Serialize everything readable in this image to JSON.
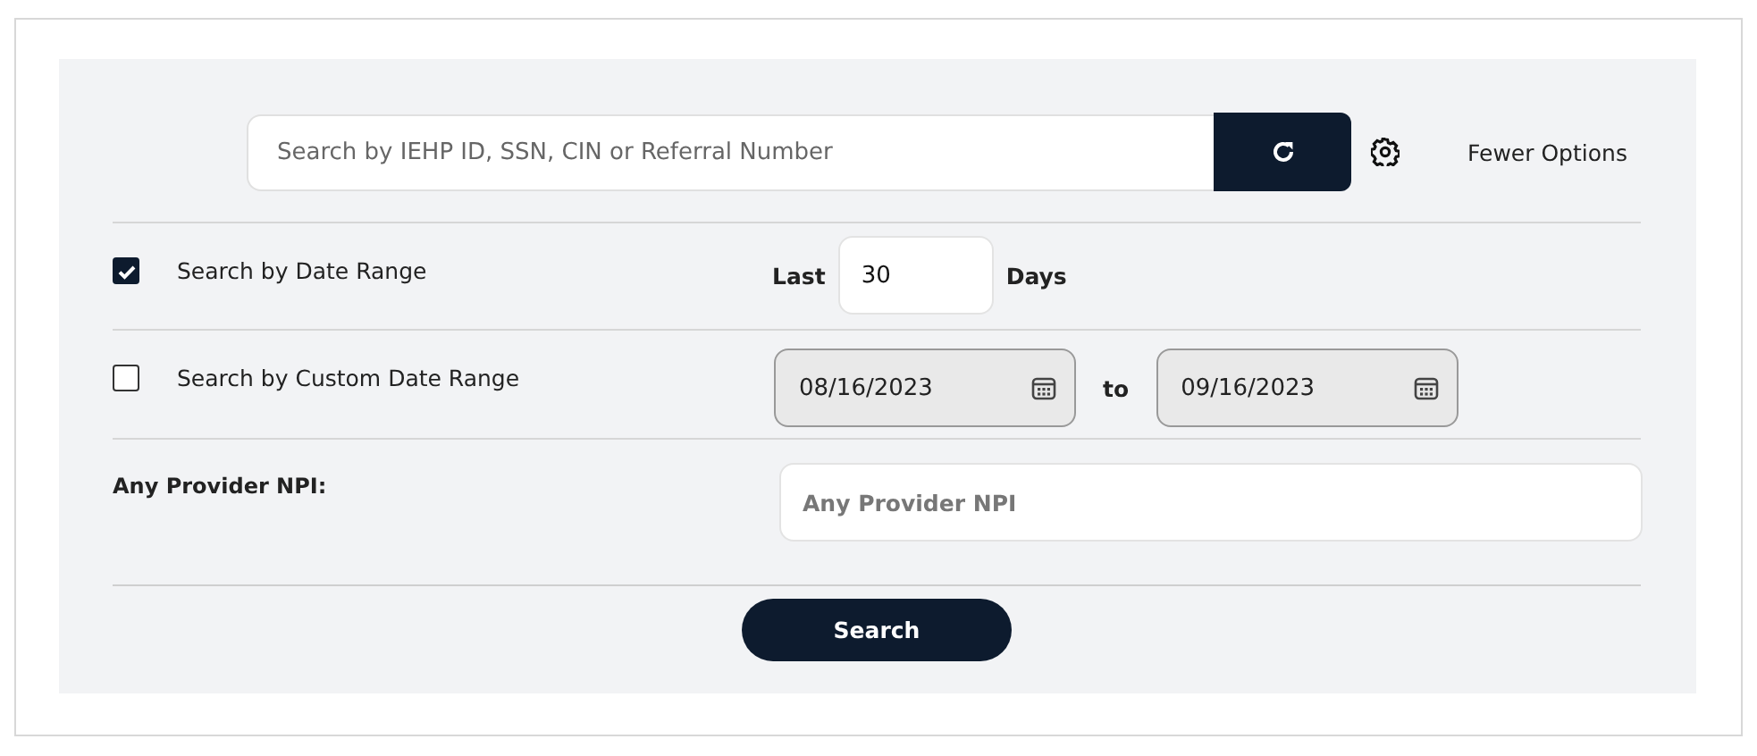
{
  "search": {
    "placeholder": "Search by IEHP ID, SSN, CIN or Referral Number",
    "toggle_link": "Fewer Options"
  },
  "rows": [
    {
      "kind": "last_days",
      "label": "Search by Date Range",
      "checked": true,
      "prefix": "Last",
      "value": "30",
      "suffix": "Days"
    },
    {
      "kind": "date_range",
      "label": "Search by Custom Date Range",
      "checked": false,
      "disabled": true,
      "from": "08/16/2023",
      "joiner": "to",
      "to": "09/16/2023"
    },
    {
      "kind": "text_field",
      "label": "Any Provider NPI:",
      "placeholder": "Any Provider NPI"
    }
  ],
  "search_button": "Search"
}
